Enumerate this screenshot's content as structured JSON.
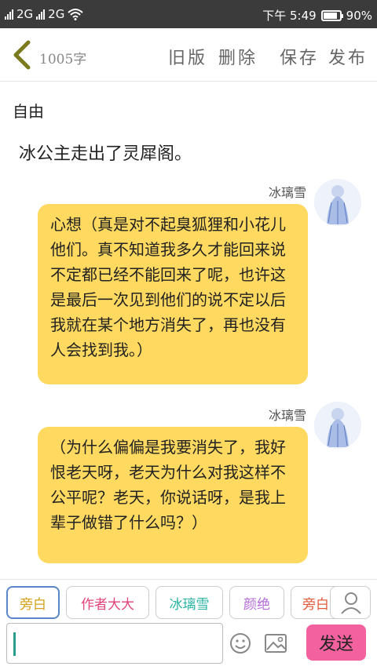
{
  "status_bar": {
    "sim1": "2G",
    "sim2": "2G",
    "time": "下午 5:49",
    "battery_text": "90%",
    "battery_level": 0.9
  },
  "toolbar": {
    "word_count": "1005字",
    "old_version": "旧版",
    "delete": "删除",
    "save": "保存",
    "publish": "发布"
  },
  "free_label": "自由",
  "narration": "冰公主走出了灵犀阁。",
  "messages": [
    {
      "speaker": "冰璃雪",
      "text": "心想（真是对不起臭狐狸和小花儿他们。真不知道我多久才能回来说不定都已经不能回来了呢，也许这是最后一次见到他们的说不定以后我就在某个地方消失了，再也没有人会找到我。）"
    },
    {
      "speaker": "冰璃雪",
      "text": "（为什么偏偏是我要消失了，我好恨老天呀，老天为什么对我这样不公平呢？老天，你说话呀，是我上辈子做错了什么吗？）"
    }
  ],
  "chips": [
    {
      "label": "旁白",
      "color": "#d4a017"
    },
    {
      "label": "作者大大",
      "color": "#e0457b"
    },
    {
      "label": "冰璃雪",
      "color": "#2bb3a4"
    },
    {
      "label": "颜绝",
      "color": "#b36bd6"
    },
    {
      "label": "旁白",
      "color": "#e05a3a"
    }
  ],
  "input": {
    "placeholder": ""
  },
  "send_label": "发送",
  "colors": {
    "bubble": "#ffd960",
    "send": "#f4619f",
    "statusbar": "#3b3b3b"
  }
}
